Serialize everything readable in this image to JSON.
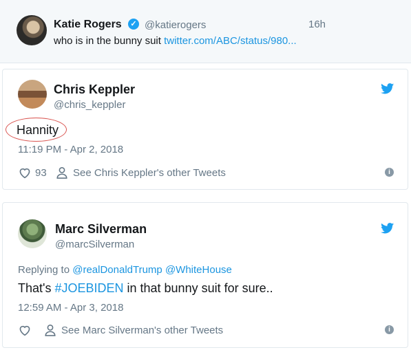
{
  "quoted_tweet": {
    "name": "Katie Rogers",
    "handle": "@katierogers",
    "time": "16h",
    "text": "who is in the bunny suit ",
    "link": "twitter.com/ABC/status/980..."
  },
  "tweets": [
    {
      "name": "Chris Keppler",
      "handle": "@chris_keppler",
      "text": "Hannity",
      "timestamp": "11:19 PM - Apr 2, 2018",
      "like_count": "93",
      "other_tweets": "See Chris Keppler's other Tweets"
    },
    {
      "name": "Marc Silverman",
      "handle": "@marcSilverman",
      "reply_prefix": "Replying to ",
      "reply_to_1": "@realDonaldTrump",
      "reply_to_2": "@WhiteHouse",
      "text_before": "That's ",
      "hashtag": "#JOEBIDEN",
      "text_after": " in that bunny suit for sure..",
      "timestamp": "12:59 AM - Apr 3, 2018",
      "other_tweets": "See Marc Silverman's other Tweets"
    }
  ],
  "colors": {
    "link": "#1b95e0",
    "twitter_blue": "#1da1f2",
    "highlight_circle": "#d9534f"
  },
  "icons": [
    "verified-badge-icon",
    "twitter-bird-icon",
    "heart-icon",
    "person-icon",
    "info-icon"
  ]
}
